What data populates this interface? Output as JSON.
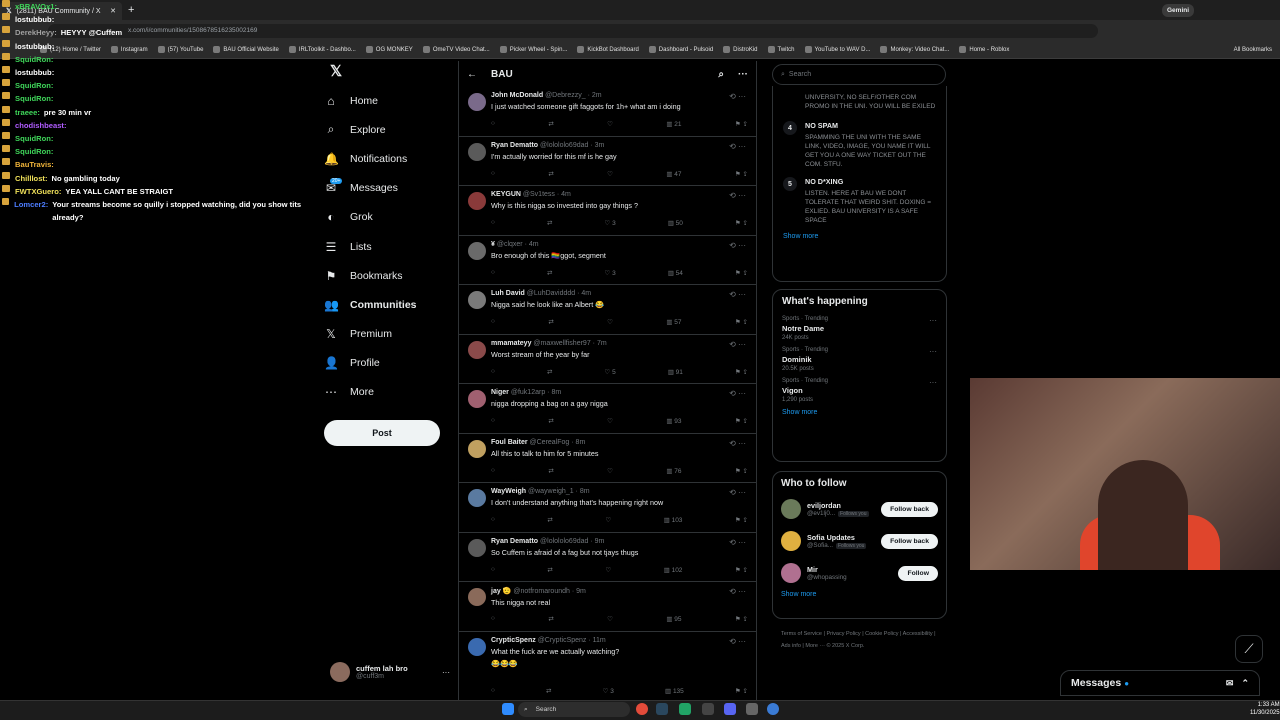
{
  "browser": {
    "tab_title": "(2811) BAU Community / X",
    "url": "x.com/i/communities/1508678516235002169",
    "gemini": "Gemini",
    "bookmarks": [
      "(12) Home / Twitter",
      "Instagram",
      "(57) YouTube",
      "BAU Official Website",
      "IRLToolkit - Dashbo...",
      "OG MONKEY",
      "OmeTV Video Chat...",
      "Picker Wheel - Spin...",
      "KickBot Dashboard",
      "Dashboard - Pulsoid",
      "DistroKid",
      "Twitch",
      "YouTube to WAV D...",
      "Monkey: Video Chat...",
      "Home - Roblox"
    ],
    "all_bookmarks": "All Bookmarks"
  },
  "chat": [
    {
      "user": "xBRAVOx1:",
      "msg": "",
      "color": "#3fd65a"
    },
    {
      "user": "lostubbub:",
      "msg": "",
      "color": "#ffffff"
    },
    {
      "user": "DerekHeyy:",
      "msg": "HEYYY @Cuffem",
      "color": "#a0a0a0"
    },
    {
      "user": "lostubbub:",
      "msg": "",
      "color": "#ffffff"
    },
    {
      "user": "SquidRon:",
      "msg": "",
      "color": "#3fd65a"
    },
    {
      "user": "lostubbub:",
      "msg": "",
      "color": "#ffffff"
    },
    {
      "user": "SquidRon:",
      "msg": "",
      "color": "#3fd65a"
    },
    {
      "user": "SquidRon:",
      "msg": "",
      "color": "#3fd65a"
    },
    {
      "user": "traeee:",
      "msg": "pre 30 min vr",
      "color": "#3fd65a"
    },
    {
      "user": "chodishbeast:",
      "msg": "",
      "color": "#b05cff"
    },
    {
      "user": "SquidRon:",
      "msg": "",
      "color": "#3fd65a"
    },
    {
      "user": "SquidRon:",
      "msg": "",
      "color": "#3fd65a"
    },
    {
      "user": "BauTravis:",
      "msg": "",
      "color": "#f0b43a"
    },
    {
      "user": "Chilllost:",
      "msg": "No gambling today",
      "color": "#f0e15a"
    },
    {
      "user": "FWTXGuero:",
      "msg": "YEA YALL CANT BE STRAIGT",
      "color": "#f0e15a"
    },
    {
      "user": "Lomcer2:",
      "msg": "Your streams become so quilly i stopped watching, did you show tits already?",
      "color": "#4d7dff"
    }
  ],
  "nav": {
    "items": [
      "Home",
      "Explore",
      "Notifications",
      "Messages",
      "Grok",
      "Lists",
      "Bookmarks",
      "Communities",
      "Premium",
      "Profile",
      "More"
    ],
    "icons": [
      "home-icon",
      "search-icon",
      "bell-icon",
      "mail-icon",
      "grok-icon",
      "list-icon",
      "bookmark-icon",
      "communities-icon",
      "x-icon",
      "person-icon",
      "more-icon"
    ],
    "post": "Post",
    "messages_badge": "20+",
    "account_name": "cuffem lah bro",
    "account_handle": "@cuff3m"
  },
  "timeline": {
    "title": "BAU",
    "tweets": [
      {
        "name": "John McDonald",
        "handle": "@Debrezzy_",
        "time": "2m",
        "text": "I just watched someone gift faggots for 1h+ what am i doing",
        "likes": "",
        "views": "21",
        "rt": ""
      },
      {
        "name": "Ryan Demattо",
        "handle": "@lolololo69dad",
        "time": "3m",
        "text": "I'm actually worried for this mf is he gay",
        "likes": "",
        "views": "47",
        "rt": ""
      },
      {
        "name": "KEYGUN",
        "handle": "@Sv1tess",
        "time": "4m",
        "text": "Why is this nigga so invested into gay things ?",
        "likes": "3",
        "views": "50",
        "rt": ""
      },
      {
        "name": "¥",
        "handle": "@clqxer",
        "time": "4m",
        "text": "Bro enough of this 🏳️‍🌈ggot, segment",
        "likes": "3",
        "views": "54",
        "rt": ""
      },
      {
        "name": "Luh David",
        "handle": "@LuhDavidddd",
        "time": "4m",
        "text": "Nigga said he look like an Albert 😂",
        "likes": "",
        "views": "57",
        "rt": ""
      },
      {
        "name": "mmamateyy",
        "handle": "@maxwellfisher97",
        "time": "7m",
        "text": "Worst stream of the year by far",
        "likes": "5",
        "views": "91",
        "rt": ""
      },
      {
        "name": "Niger",
        "handle": "@fuk12arp",
        "time": "8m",
        "text": "nigga dropping a bag on a gay nigga",
        "likes": "",
        "views": "93",
        "rt": ""
      },
      {
        "name": "Foul Baiter",
        "handle": "@CerealFog",
        "time": "8m",
        "text": "All this to talk to him for 5 minutes",
        "likes": "",
        "views": "76",
        "rt": ""
      },
      {
        "name": "WayWeigh",
        "handle": "@wayweigh_1",
        "time": "8m",
        "text": "I don't understand anything that's happening right now",
        "likes": "",
        "views": "103",
        "rt": ""
      },
      {
        "name": "Ryan Demattо",
        "handle": "@lolololo69dad",
        "time": "9m",
        "text": "So Cuffem is afraid of a fag but not tjays thugs",
        "likes": "",
        "views": "102",
        "rt": ""
      },
      {
        "name": "jay 🫡",
        "handle": "@notfromaroundh",
        "time": "9m",
        "text": "This nigga not real",
        "likes": "",
        "views": "95",
        "rt": ""
      },
      {
        "name": "CrypticSpenz",
        "handle": "@CrypticSpenz",
        "time": "11m",
        "text": "What the fuck are we actually watching?",
        "likes": "3",
        "views": "135",
        "rt": ""
      }
    ],
    "last_emoji": "😂😂😂"
  },
  "right": {
    "search_placeholder": "Search",
    "rules_top": "UNIVERSITY, NO SELF/OTHER COM PROMO IN THE UNI. YOU WILL BE EXILED",
    "rules": [
      {
        "num": "4",
        "title": "NO SPAM",
        "desc": "SPAMMING THE UNI WITH THE SAME LINK, VIDEO, IMAGE, YOU NAME IT WILL GET YOU A ONE WAY TICKET OUT THE COM. STFU."
      },
      {
        "num": "5",
        "title": "NO D*XING",
        "desc": "LISTEN. HERE AT BAU WE DONT TOLERATE THAT WEIRD SHIT. DOXING = EXLIED. BAU UNIVERSITY IS A SAFE SPACE"
      }
    ],
    "show_more": "Show more",
    "happening_title": "What's happening",
    "trends": [
      {
        "cat": "Sports · Trending",
        "name": "Notre Dame",
        "posts": "24K posts"
      },
      {
        "cat": "Sports · Trending",
        "name": "Dominik",
        "posts": "20.5K posts"
      },
      {
        "cat": "Sports · Trending",
        "name": "Vigon",
        "posts": "1,290 posts"
      }
    ],
    "wtf_title": "Who to follow",
    "follows": [
      {
        "name": "eviljordan",
        "handle": "@ev1lj0...",
        "tag": "Follows you",
        "btn": "Follow back"
      },
      {
        "name": "Sofia Updates",
        "handle": "@Sofia...",
        "tag": "Follows you",
        "btn": "Follow back"
      },
      {
        "name": "Mir",
        "handle": "@whopassing",
        "tag": "",
        "btn": "Follow"
      }
    ],
    "footer": "Terms of Service | Privacy Policy | Cookie Policy | Accessibility | Ads info | More ··· © 2025 X Corp."
  },
  "messages_drawer": "Messages",
  "taskbar": {
    "search": "Search",
    "time": "1:33 AM",
    "date": "11/30/2025"
  }
}
